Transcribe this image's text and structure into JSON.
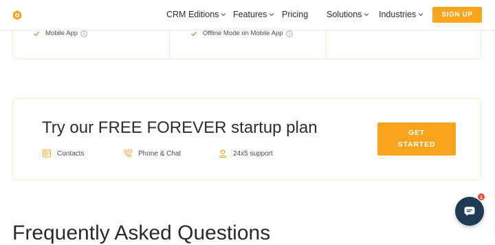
{
  "nav": {
    "items": [
      {
        "label": "CRM Editions",
        "dropdown": true
      },
      {
        "label": "Features",
        "dropdown": true
      },
      {
        "label": "Pricing",
        "dropdown": false
      },
      {
        "label": "Solutions",
        "dropdown": true
      },
      {
        "label": "Industries",
        "dropdown": true
      }
    ],
    "signup_label": "SIGN UP"
  },
  "features_row": {
    "items": [
      {
        "label": "Mobile App",
        "icon": "check-icon",
        "info_icon": "info-icon"
      },
      {
        "label": "Offline Mode on Mobile App",
        "icon": "check-icon",
        "info_icon": "info-icon"
      }
    ]
  },
  "cta": {
    "title": "Try our FREE FOREVER startup plan",
    "features": [
      {
        "label": "Contacts",
        "icon": "contacts-icon"
      },
      {
        "label": "Phone & Chat",
        "icon": "phone-chat-icon"
      },
      {
        "label": "24x5 support",
        "icon": "support-agent-icon"
      }
    ],
    "button_line1": "GET",
    "button_line2": "STARTED"
  },
  "faq": {
    "heading": "Frequently Asked Questions"
  },
  "chat_widget": {
    "badge_count": "1",
    "icon": "chat-icon"
  },
  "colors": {
    "accent": "#f9a51b",
    "check": "#6dbb4f",
    "chat_bg": "#1f3a52",
    "badge": "#e4502f",
    "border": "#f4ecd6"
  }
}
